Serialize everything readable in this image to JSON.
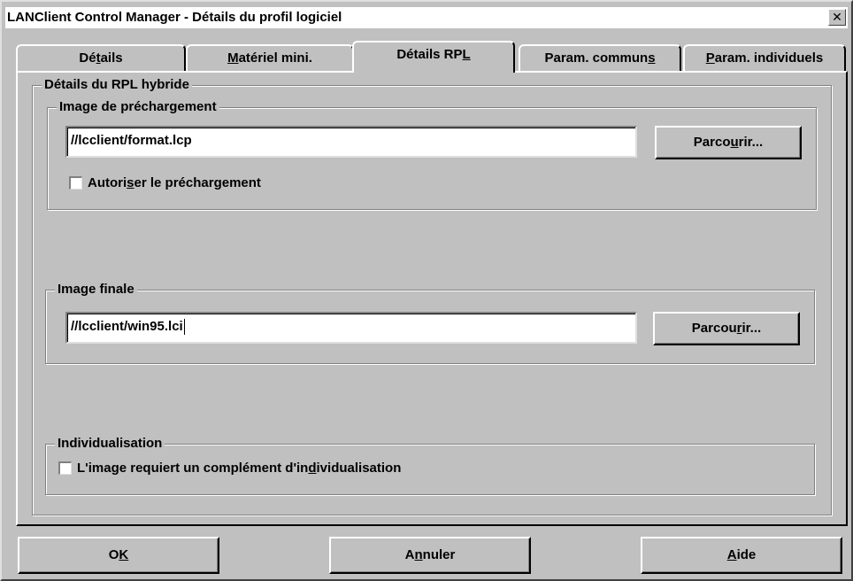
{
  "window": {
    "title": "LANClient Control Manager - Détails du profil logiciel",
    "close_glyph": "✕"
  },
  "tabs": [
    {
      "before": "Dé",
      "key": "t",
      "after": "ails"
    },
    {
      "before": "",
      "key": "M",
      "after": "atériel mini."
    },
    {
      "before": "Détails RP",
      "key": "L",
      "after": ""
    },
    {
      "before": "Param. commun",
      "key": "s",
      "after": ""
    },
    {
      "before": "",
      "key": "P",
      "after": "aram. individuels"
    }
  ],
  "active_tab": "Détails RPL",
  "panel": {
    "hybrid_group_label": "Détails du RPL hybride",
    "preload": {
      "label": "Image de préchargement",
      "value": "//lcclient/format.lcp",
      "browse": {
        "before": "Parco",
        "key": "u",
        "after": "rir..."
      },
      "allow_checkbox": {
        "before": "Autori",
        "key": "s",
        "after": "er le préchargement"
      },
      "allow_checked": false
    },
    "final": {
      "label": "Image finale",
      "value": "//lcclient/win95.lci",
      "browse": {
        "before": "Parcou",
        "key": "r",
        "after": "ir..."
      }
    },
    "individualisation": {
      "label": "Individualisation",
      "checkbox": {
        "before": "L'image requiert un complément d'in",
        "key": "d",
        "after": "ividualisation"
      },
      "checked": false
    }
  },
  "buttons": {
    "ok": {
      "before": "O",
      "key": "K",
      "after": ""
    },
    "cancel": {
      "before": "A",
      "key": "n",
      "after": "nuler"
    },
    "help": {
      "before": "",
      "key": "A",
      "after": "ide"
    }
  }
}
